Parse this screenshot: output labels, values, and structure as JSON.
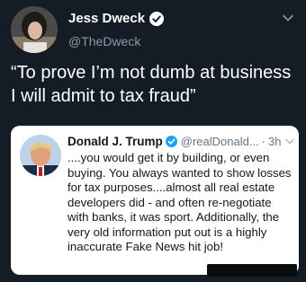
{
  "tweet": {
    "author_name": "Jess Dweck",
    "author_handle": "@TheDweck",
    "text": "“To prove I’m not dumb at business I will admit to tax fraud”"
  },
  "quoted_tweet": {
    "author_name": "Donald J. Trump",
    "author_handle": "@realDonald...",
    "separator": "·",
    "time": "3h",
    "text": "....you would get it by building, or even buying. You always wanted to show losses for tax purposes....almost all real estate developers did - and often re-negotiate with banks, it was sport. Additionally, the very old information put out is a highly inaccurate Fake News hit job!"
  },
  "colors": {
    "background": "#141d26",
    "verified_blue": "#1da1f2",
    "secondary_text": "#8899a6",
    "card_background": "#ffffff"
  },
  "icons": [
    "verified-badge-icon",
    "chevron-down-icon"
  ]
}
